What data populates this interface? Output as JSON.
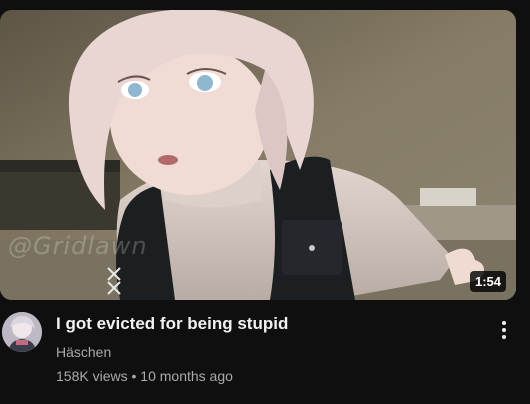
{
  "video": {
    "title": "I got evicted for being stupid",
    "channel": "Häschen",
    "views": "158K views",
    "separator": "•",
    "age": "10 months ago",
    "duration": "1:54",
    "watermark": "@Gridlawn"
  },
  "icons": {
    "more": "vertical-ellipsis-icon"
  },
  "colors": {
    "background": "#0f0f0f",
    "title": "#f1f1f1",
    "secondary_text": "#aaaaaa"
  }
}
